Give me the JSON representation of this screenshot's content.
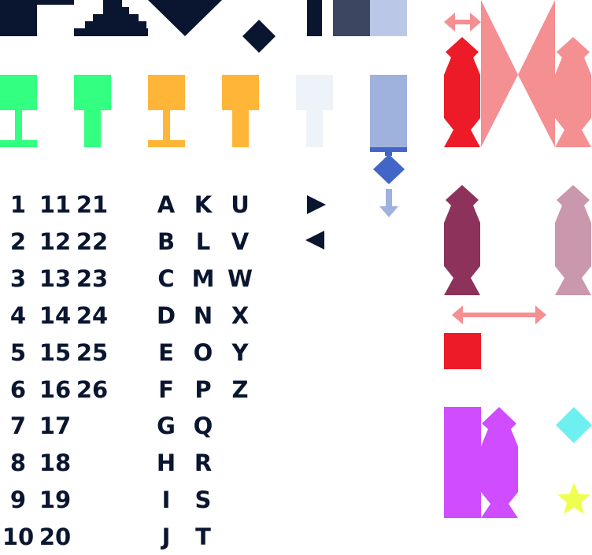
{
  "colors": {
    "navy": "#0a1630",
    "slate": "#3d4660",
    "periwinkle": "#bac7e6",
    "green": "#33ff80",
    "amber": "#ffb638",
    "pale": "#eef2f9",
    "blue_light": "#9fb2de",
    "blue": "#4266c7",
    "red": "#ed1b27",
    "salmon": "#f48f92",
    "plum": "#8d325b",
    "mauve": "#c998ac",
    "violet": "#cf4cff",
    "cyan": "#6ff0f0",
    "yellow": "#efff4f"
  },
  "icons": {
    "scroll_right": "triangle-right-icon",
    "scroll_left": "triangle-left-icon",
    "move_down": "arrow-down-icon",
    "resize_horizontal": "double-arrow-horizontal-icon"
  },
  "numbers": {
    "col1": [
      "1",
      "2",
      "3",
      "4",
      "5",
      "6",
      "7",
      "8",
      "9",
      "10"
    ],
    "col2": [
      "11",
      "12",
      "13",
      "14",
      "15",
      "16",
      "17",
      "18",
      "19",
      "20"
    ],
    "col3": [
      "21",
      "22",
      "23",
      "24",
      "25",
      "26"
    ]
  },
  "letters": {
    "col1": [
      "A",
      "B",
      "C",
      "D",
      "E",
      "F",
      "G",
      "H",
      "I",
      "J"
    ],
    "col2": [
      "K",
      "L",
      "M",
      "N",
      "O",
      "P",
      "Q",
      "R",
      "S",
      "T"
    ],
    "col3": [
      "U",
      "V",
      "W",
      "X",
      "Y",
      "Z"
    ]
  }
}
